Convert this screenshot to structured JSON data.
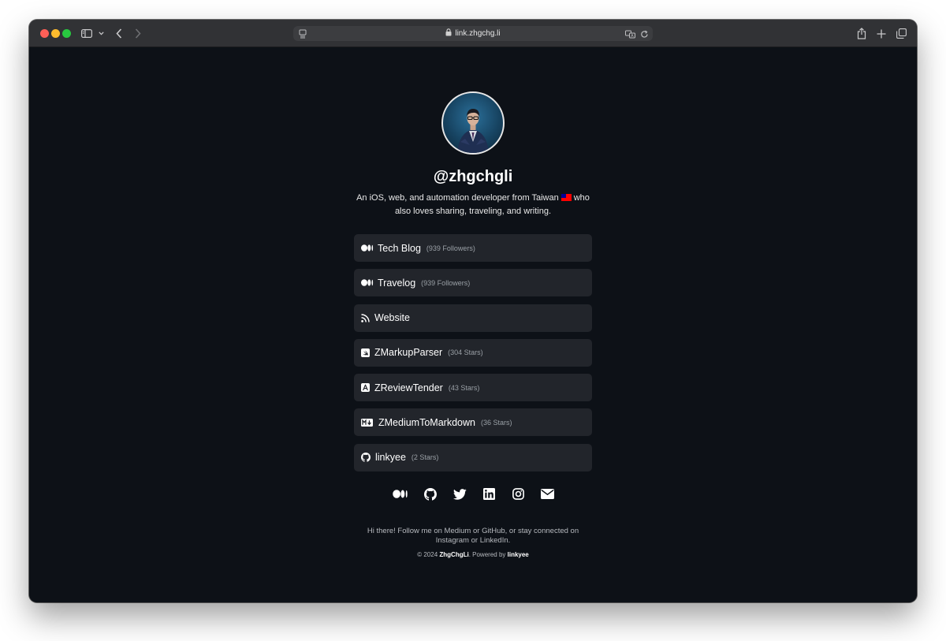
{
  "browser": {
    "url": "link.zhgchg.li"
  },
  "profile": {
    "username": "@zhgchgli",
    "bio_part1": "An iOS, web, and automation developer from Taiwan",
    "bio_part2": "who also loves sharing, traveling, and writing."
  },
  "links": [
    {
      "icon": "medium-icon",
      "title": "Tech Blog",
      "meta": "(939 Followers)"
    },
    {
      "icon": "medium-icon",
      "title": "Travelog",
      "meta": "(939 Followers)"
    },
    {
      "icon": "rss-icon",
      "title": "Website",
      "meta": ""
    },
    {
      "icon": "swift-icon",
      "title": "ZMarkupParser",
      "meta": "(304 Stars)"
    },
    {
      "icon": "app-store-icon",
      "title": "ZReviewTender",
      "meta": "(43 Stars)"
    },
    {
      "icon": "markdown-icon",
      "title": "ZMediumToMarkdown",
      "meta": "(36 Stars)"
    },
    {
      "icon": "github-icon",
      "title": "linkyee",
      "meta": "(2 Stars)"
    }
  ],
  "socials": [
    "medium-icon",
    "github-icon",
    "twitter-icon",
    "linkedin-icon",
    "instagram-icon",
    "email-icon"
  ],
  "footer": {
    "note": "Hi there! Follow me on Medium or GitHub, or stay connected on Instagram or LinkedIn.",
    "copyright_prefix": "© 2024 ",
    "owner": "ZhgChgLi",
    "powered_text": ". Powered by ",
    "powered_link": "linkyee"
  },
  "colors": {
    "page_background": "#0d1117",
    "card_background": "#22252b",
    "toolbar_background": "#313235"
  }
}
